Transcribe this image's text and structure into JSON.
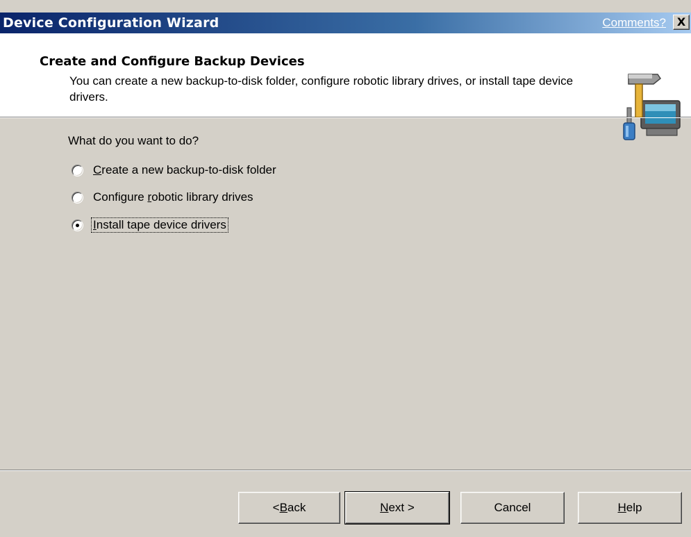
{
  "window": {
    "title": "Device Configuration Wizard",
    "comments_link": "Comments?",
    "close_glyph": "X"
  },
  "header": {
    "heading": "Create and Configure Backup Devices",
    "description": "You can create a new backup-to-disk folder, configure robotic library drives, or install tape device drivers.",
    "icon": "hammer-screwdriver-computer-icon"
  },
  "body": {
    "question": "What do you want to do?",
    "options": [
      {
        "pre": "",
        "accel": "C",
        "post": "reate a new backup-to-disk folder",
        "checked": false
      },
      {
        "pre": "Configure ",
        "accel": "r",
        "post": "obotic library drives",
        "checked": false
      },
      {
        "pre": "",
        "accel": "I",
        "post": "nstall tape device drivers",
        "checked": true
      }
    ]
  },
  "buttons": {
    "back": {
      "pre": "< ",
      "accel": "B",
      "post": "ack"
    },
    "next": {
      "pre": "",
      "accel": "N",
      "post": "ext >"
    },
    "cancel": {
      "label": "Cancel"
    },
    "help": {
      "pre": "",
      "accel": "H",
      "post": "elp"
    }
  },
  "colors": {
    "titlebar_start": "#0a246a",
    "titlebar_end": "#a6caf0",
    "dialog_face": "#d4d0c8",
    "header_bg": "#ffffff"
  }
}
